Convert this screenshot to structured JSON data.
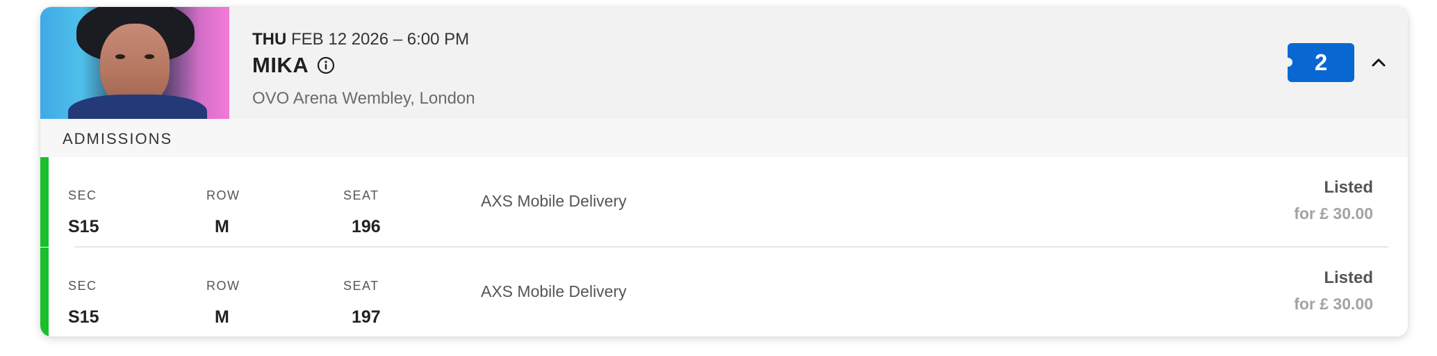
{
  "event": {
    "day": "THU",
    "date_time": "FEB 12 2026 – 6:00 PM",
    "title": "MIKA",
    "venue": "OVO Arena Wembley, London",
    "image_icon": "artist-photo",
    "info_icon": "info-circle-icon",
    "ticket_count": "2",
    "toggle_icon": "chevron-up-icon"
  },
  "admissions": {
    "header": "ADMISSIONS",
    "labels": {
      "sec": "SEC",
      "row": "ROW",
      "seat": "SEAT"
    },
    "tickets": [
      {
        "sec": "S15",
        "row": "M",
        "seat": "196",
        "delivery": "AXS Mobile Delivery",
        "status": "Listed",
        "price": "for £ 30.00"
      },
      {
        "sec": "S15",
        "row": "M",
        "seat": "197",
        "delivery": "AXS Mobile Delivery",
        "status": "Listed",
        "price": "for £ 30.00"
      }
    ]
  },
  "colors": {
    "accent_green": "#18c02b",
    "badge_blue": "#0967d2",
    "header_bg": "#f2f2f2"
  }
}
